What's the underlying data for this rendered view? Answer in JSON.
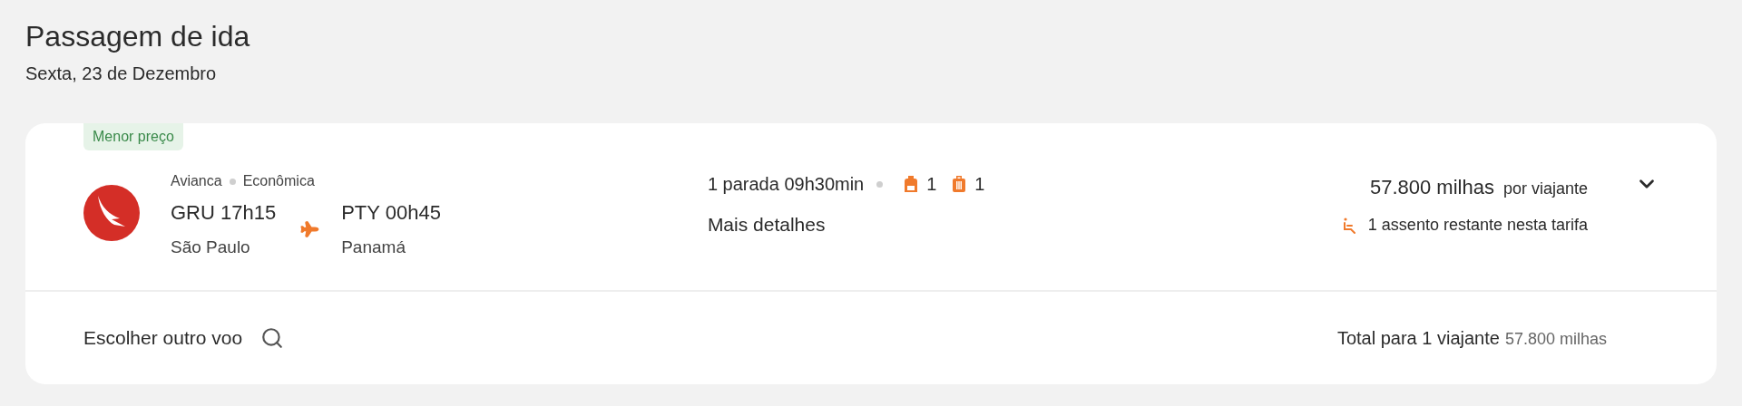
{
  "header": {
    "title": "Passagem de ida",
    "date": "Sexta, 23 de Dezembro"
  },
  "flight": {
    "badge": "Menor preço",
    "airline": "Avianca",
    "cabin": "Econômica",
    "departure": {
      "code_time": "GRU 17h15",
      "city": "São Paulo"
    },
    "arrival": {
      "code_time": "PTY 00h45",
      "city": "Panamá"
    },
    "stops": "1 parada 09h30min",
    "carry_on": "1",
    "checked_bags": "1",
    "details_link": "Mais detalhes",
    "price": "57.800 milhas",
    "price_unit": "por viajante",
    "seats_left": "1 assento restante nesta tarifa"
  },
  "footer": {
    "other_flight": "Escolher outro voo",
    "total_label": "Total para 1 viajante",
    "total_value": "57.800 milhas"
  }
}
